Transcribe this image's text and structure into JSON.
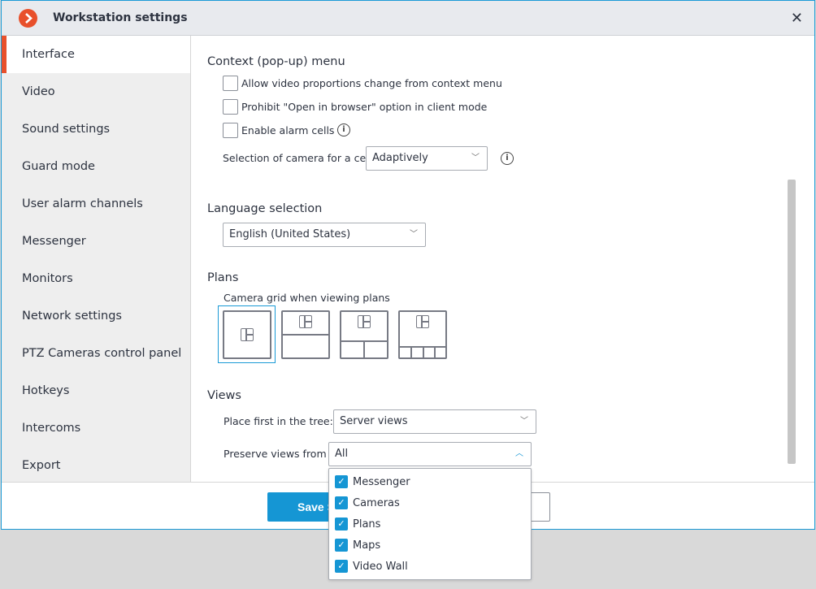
{
  "window": {
    "title": "Workstation settings",
    "close_icon": "close-icon",
    "accent": "#1596d4",
    "brand": "#e8502b"
  },
  "sidebar": {
    "items": [
      {
        "label": "Interface",
        "active": true
      },
      {
        "label": "Video"
      },
      {
        "label": "Sound settings"
      },
      {
        "label": "Guard mode"
      },
      {
        "label": "User alarm channels"
      },
      {
        "label": "Messenger"
      },
      {
        "label": "Monitors"
      },
      {
        "label": "Network settings"
      },
      {
        "label": "PTZ Cameras control panel"
      },
      {
        "label": "Hotkeys"
      },
      {
        "label": "Intercoms"
      },
      {
        "label": "Export"
      }
    ]
  },
  "context_menu": {
    "heading": "Context (pop-up) menu",
    "options": [
      {
        "label": "Allow video proportions change from context menu",
        "checked": false
      },
      {
        "label": "Prohibit \"Open in browser\" option in client mode",
        "checked": false
      },
      {
        "label": "Enable alarm cells",
        "checked": false
      }
    ],
    "camera_selection_label": "Selection of camera for a cell",
    "camera_selection_value": "Adaptively"
  },
  "language": {
    "heading": "Language selection",
    "value": "English (United States)"
  },
  "plans": {
    "heading": "Plans",
    "grid_label": "Camera grid when viewing plans",
    "selected_grid": 1
  },
  "views": {
    "heading": "Views",
    "place_first_label": "Place first in the tree:",
    "place_first_value": "Server views",
    "preserve_label": "Preserve views from",
    "preserve_value": "All",
    "options": [
      {
        "label": "Messenger",
        "checked": true
      },
      {
        "label": "Cameras",
        "checked": true
      },
      {
        "label": "Plans",
        "checked": true
      },
      {
        "label": "Maps",
        "checked": true
      },
      {
        "label": "Video Wall",
        "checked": true
      }
    ]
  },
  "footer": {
    "save_label": "Save Settings"
  }
}
